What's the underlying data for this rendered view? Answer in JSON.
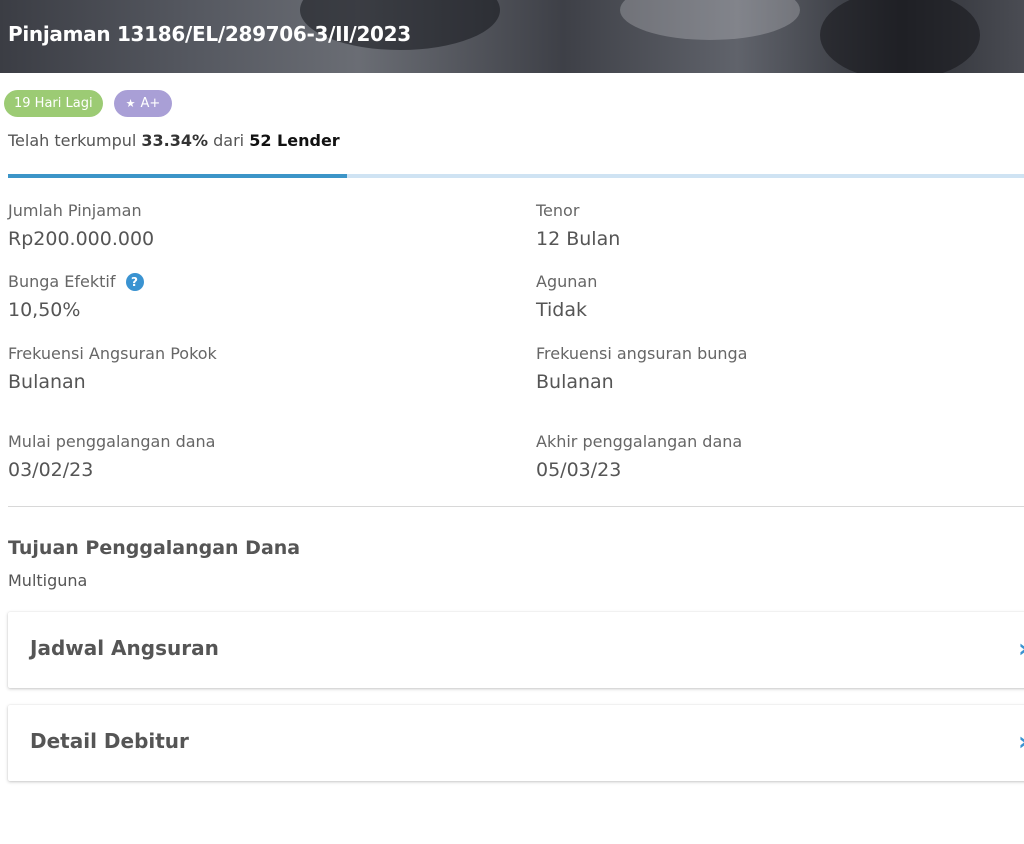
{
  "header": {
    "title": "Pinjaman 13186/EL/289706-3/II/2023"
  },
  "badges": {
    "days_left": "19 Hari Lagi",
    "rating": "A+"
  },
  "funding": {
    "prefix": "Telah terkumpul",
    "percent": "33.34%",
    "middle": "dari",
    "lenders": "52 Lender",
    "progress_fraction": 0.3334
  },
  "fields": {
    "loan_amount": {
      "label": "Jumlah Pinjaman",
      "value": "Rp200.000.000"
    },
    "tenor": {
      "label": "Tenor",
      "value": "12 Bulan"
    },
    "interest": {
      "label": "Bunga Efektif",
      "value": "10,50%"
    },
    "collateral": {
      "label": "Agunan",
      "value": "Tidak"
    },
    "principal_freq": {
      "label": "Frekuensi Angsuran Pokok",
      "value": "Bulanan"
    },
    "interest_freq": {
      "label": "Frekuensi angsuran bunga",
      "value": "Bulanan"
    },
    "start_date": {
      "label": "Mulai penggalangan dana",
      "value": "03/02/23"
    },
    "end_date": {
      "label": "Akhir penggalangan dana",
      "value": "05/03/23"
    }
  },
  "purpose": {
    "title": "Tujuan Penggalangan Dana",
    "value": "Multiguna"
  },
  "sections": {
    "schedule": "Jadwal Angsuran",
    "debtor": "Detail Debitur"
  },
  "colors": {
    "accent": "#3a93d1",
    "badge_green": "#9ccb74",
    "badge_purple": "#a99fd6",
    "progress_track": "#cfe3f3"
  }
}
